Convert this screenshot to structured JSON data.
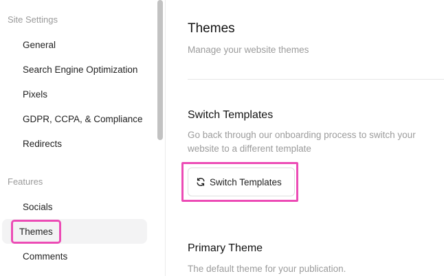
{
  "sidebar": {
    "site_settings_label": "Site Settings",
    "site_settings_items": [
      {
        "label": "General"
      },
      {
        "label": "Search Engine Optimization"
      },
      {
        "label": "Pixels"
      },
      {
        "label": "GDPR, CCPA, & Compliance"
      },
      {
        "label": "Redirects"
      }
    ],
    "features_label": "Features",
    "features_items": [
      {
        "label": "Socials"
      },
      {
        "label": "Themes",
        "active": true
      },
      {
        "label": "Comments"
      }
    ]
  },
  "main": {
    "title": "Themes",
    "subtitle": "Manage your website themes",
    "switch_section": {
      "title": "Switch Templates",
      "description_line1": "Go back through our onboarding process to switch your",
      "description_line2": "website to a different template",
      "button_label": "Switch Templates",
      "button_icon": "refresh-icon"
    },
    "primary_section": {
      "title": "Primary Theme",
      "description": "The default theme for your publication."
    }
  },
  "colors": {
    "highlight": "#ec4bb5",
    "active_bg": "#f3f3f4",
    "muted_text": "#9b9b9b"
  }
}
